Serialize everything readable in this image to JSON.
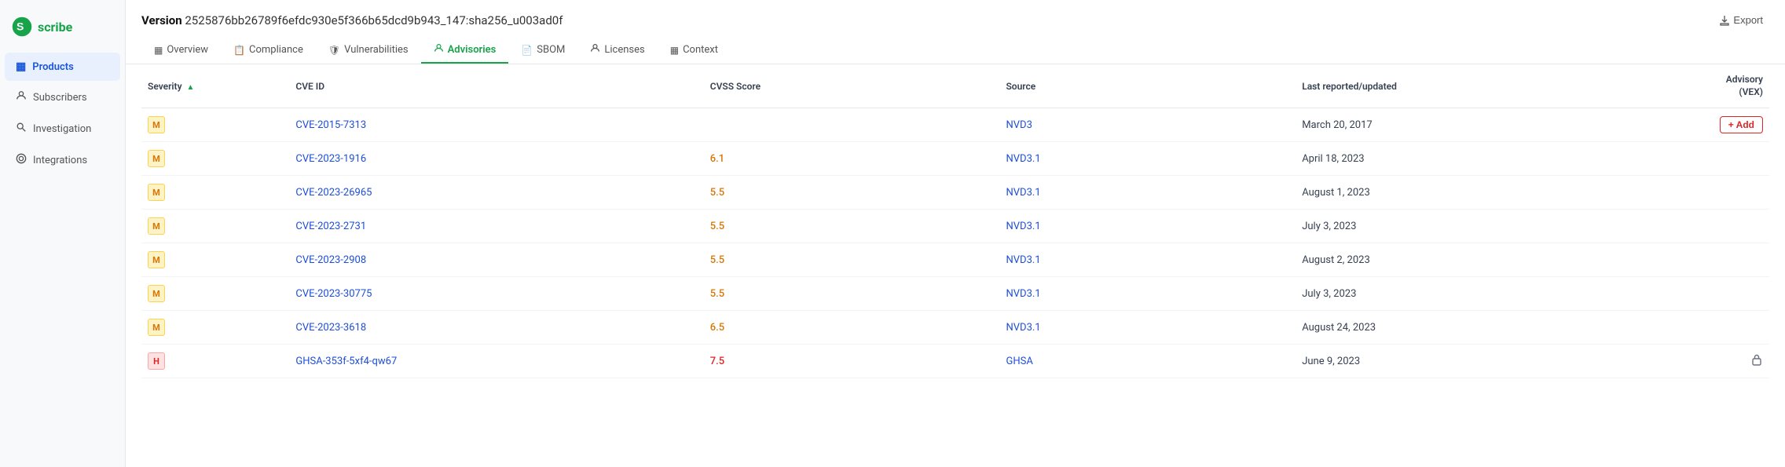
{
  "logo": {
    "text": "scribe",
    "icon": "S"
  },
  "sidebar": {
    "items": [
      {
        "id": "products",
        "label": "Products",
        "icon": "▦",
        "active": true
      },
      {
        "id": "subscribers",
        "label": "Subscribers",
        "icon": "👤"
      },
      {
        "id": "investigation",
        "label": "Investigation",
        "icon": "🔍"
      },
      {
        "id": "integrations",
        "label": "Integrations",
        "icon": "⚙"
      }
    ]
  },
  "header": {
    "version_label": "Version",
    "version_hash": "2525876bb26789f6efdc930e5f366b65dcd9b943_147:sha256_u003ad0f",
    "export_label": "Export"
  },
  "tabs": [
    {
      "id": "overview",
      "label": "Overview",
      "icon": "▦",
      "active": false
    },
    {
      "id": "compliance",
      "label": "Compliance",
      "icon": "📋",
      "active": false
    },
    {
      "id": "vulnerabilities",
      "label": "Vulnerabilities",
      "icon": "🛡",
      "active": false
    },
    {
      "id": "advisories",
      "label": "Advisories",
      "icon": "👤",
      "active": true
    },
    {
      "id": "sbom",
      "label": "SBOM",
      "icon": "📄",
      "active": false
    },
    {
      "id": "licenses",
      "label": "Licenses",
      "icon": "👤",
      "active": false
    },
    {
      "id": "context",
      "label": "Context",
      "icon": "▦",
      "active": false
    }
  ],
  "table": {
    "columns": [
      {
        "id": "severity",
        "label": "Severity",
        "sortable": true
      },
      {
        "id": "cve_id",
        "label": "CVE ID"
      },
      {
        "id": "cvss_score",
        "label": "CVSS Score"
      },
      {
        "id": "source",
        "label": "Source"
      },
      {
        "id": "last_reported",
        "label": "Last reported/updated"
      },
      {
        "id": "advisory",
        "label": "Advisory\n(VEX)"
      }
    ],
    "rows": [
      {
        "severity": "M",
        "severity_type": "medium",
        "cve_id": "CVE-2015-7313",
        "cvss_score": "",
        "source": "NVD3",
        "last_reported": "March 20, 2017",
        "advisory": "add",
        "advisory_icon": ""
      },
      {
        "severity": "M",
        "severity_type": "medium",
        "cve_id": "CVE-2023-1916",
        "cvss_score": "6.1",
        "source": "NVD3.1",
        "last_reported": "April 18, 2023",
        "advisory": "",
        "advisory_icon": ""
      },
      {
        "severity": "M",
        "severity_type": "medium",
        "cve_id": "CVE-2023-26965",
        "cvss_score": "5.5",
        "source": "NVD3.1",
        "last_reported": "August 1, 2023",
        "advisory": "",
        "advisory_icon": ""
      },
      {
        "severity": "M",
        "severity_type": "medium",
        "cve_id": "CVE-2023-2731",
        "cvss_score": "5.5",
        "source": "NVD3.1",
        "last_reported": "July 3, 2023",
        "advisory": "",
        "advisory_icon": ""
      },
      {
        "severity": "M",
        "severity_type": "medium",
        "cve_id": "CVE-2023-2908",
        "cvss_score": "5.5",
        "source": "NVD3.1",
        "last_reported": "August 2, 2023",
        "advisory": "",
        "advisory_icon": ""
      },
      {
        "severity": "M",
        "severity_type": "medium",
        "cve_id": "CVE-2023-30775",
        "cvss_score": "5.5",
        "source": "NVD3.1",
        "last_reported": "July 3, 2023",
        "advisory": "",
        "advisory_icon": ""
      },
      {
        "severity": "M",
        "severity_type": "medium",
        "cve_id": "CVE-2023-3618",
        "cvss_score": "6.5",
        "source": "NVD3.1",
        "last_reported": "August 24, 2023",
        "advisory": "",
        "advisory_icon": ""
      },
      {
        "severity": "H",
        "severity_type": "high",
        "cve_id": "GHSA-353f-5xf4-qw67",
        "cvss_score": "7.5",
        "source": "GHSA",
        "last_reported": "June 9, 2023",
        "advisory": "",
        "advisory_icon": "lock"
      }
    ]
  },
  "buttons": {
    "add_label": "+ Add",
    "export_label": "↑ Export"
  }
}
